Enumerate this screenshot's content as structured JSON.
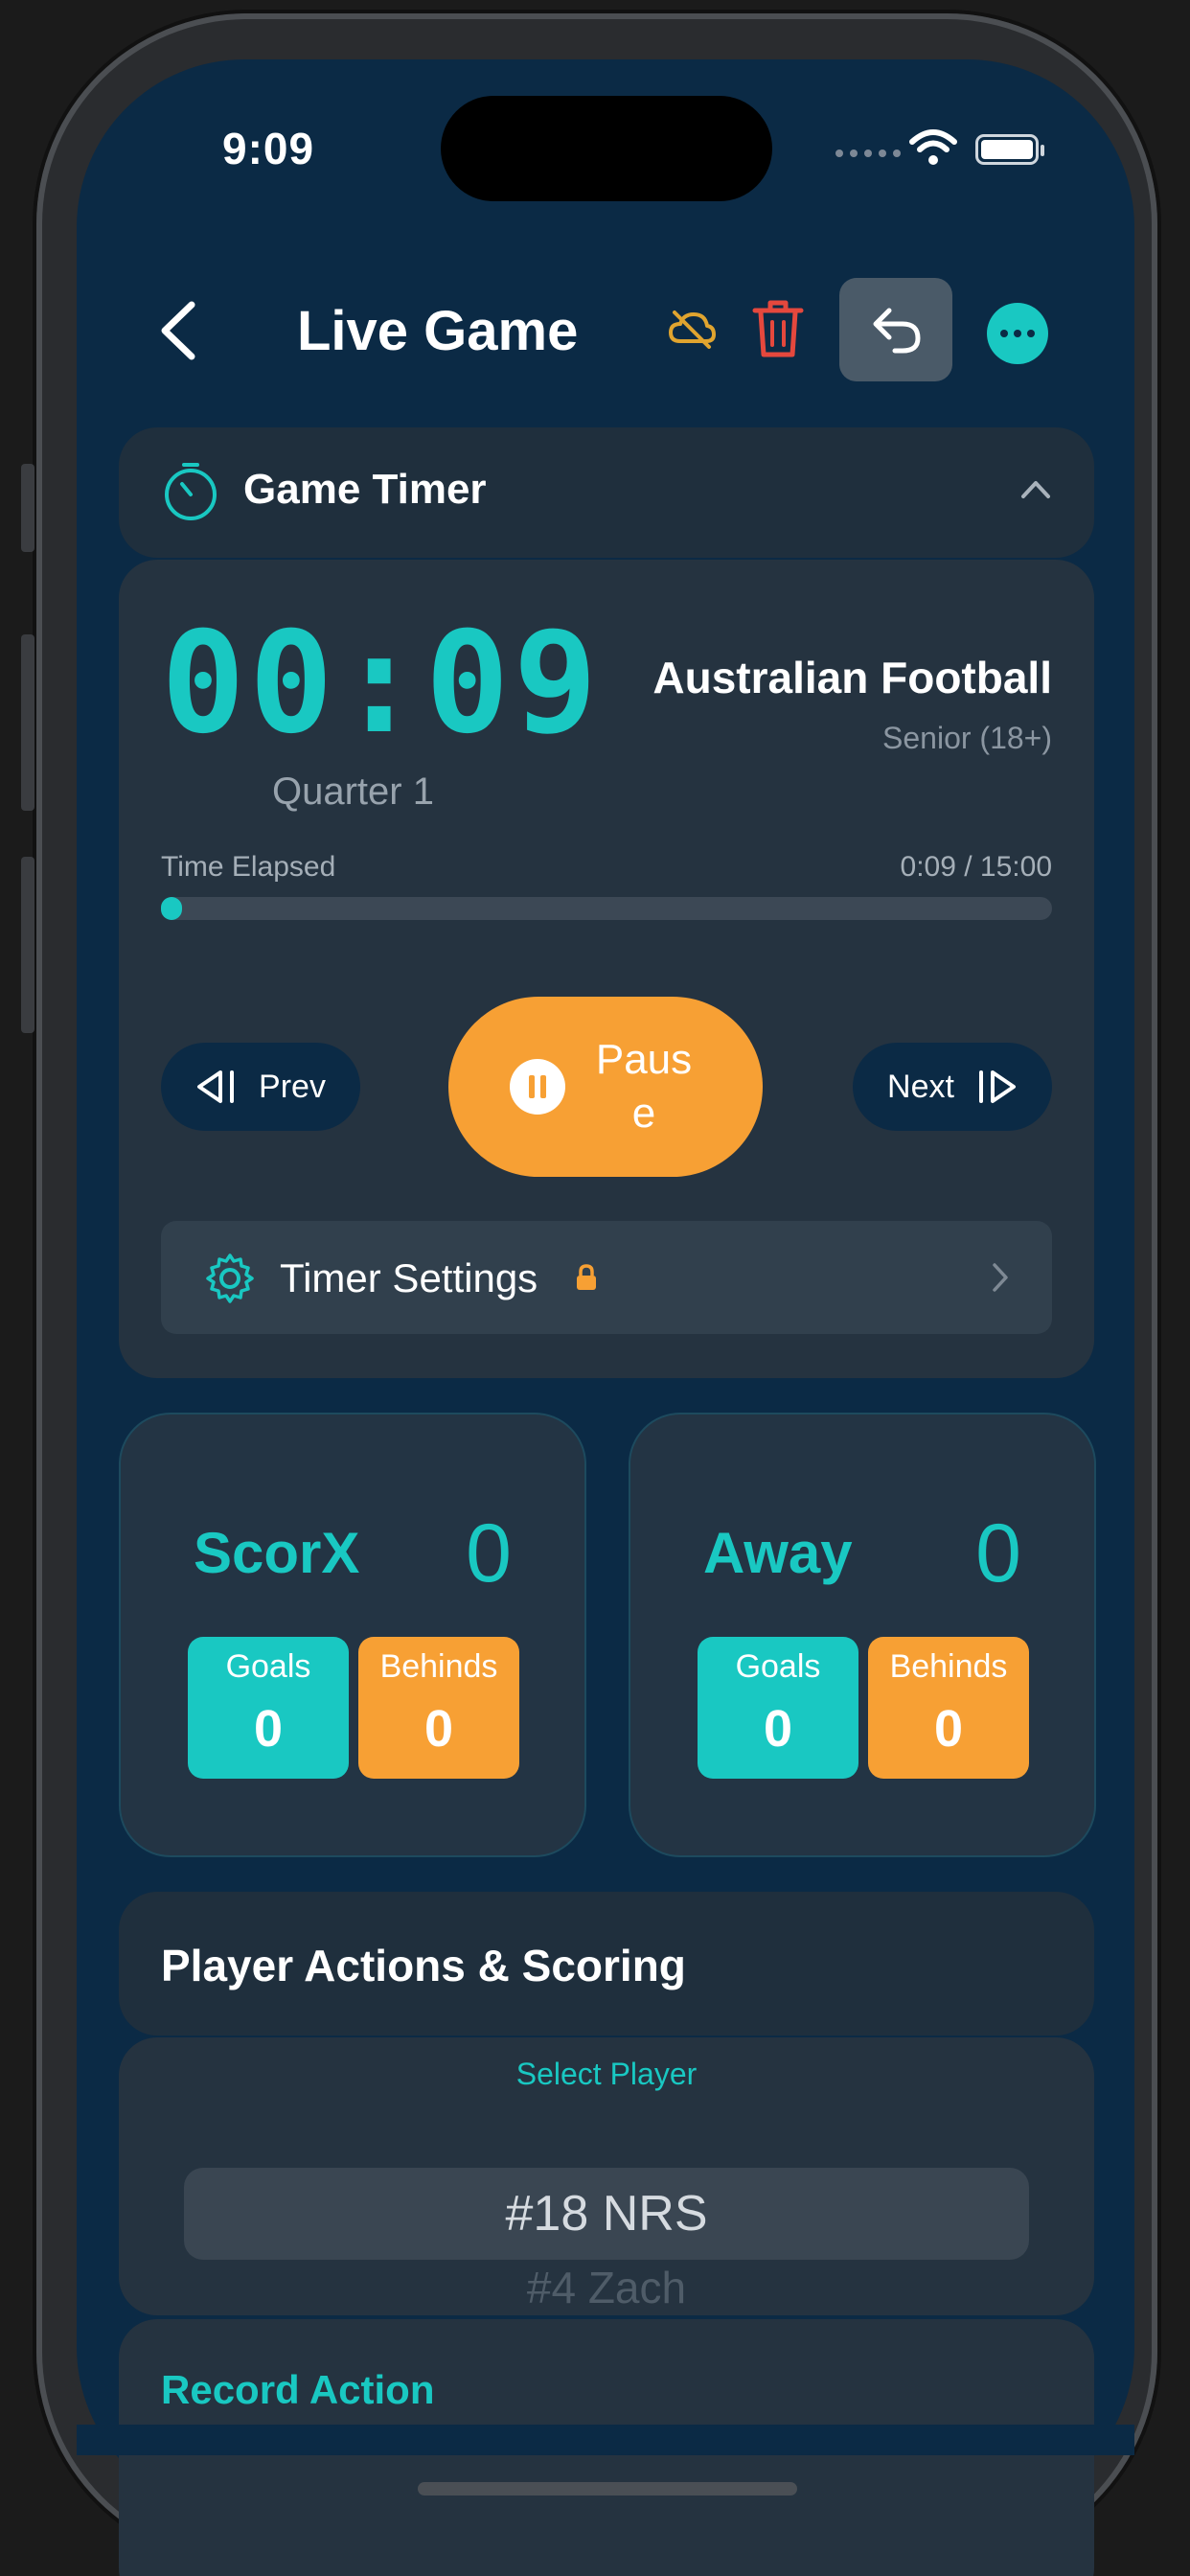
{
  "status_bar": {
    "time": "9:09"
  },
  "nav": {
    "title": "Live Game"
  },
  "timer": {
    "section_title": "Game Timer",
    "clock": "00:09",
    "period": "Quarter 1",
    "sport": "Australian Football",
    "division": "Senior (18+)",
    "elapsed_label": "Time Elapsed",
    "elapsed_value": "0:09 / 15:00",
    "progress_fraction": 0.01,
    "prev_label": "Prev",
    "pause_label": "Pause",
    "next_label": "Next",
    "settings_label": "Timer Settings"
  },
  "teams": {
    "home": {
      "name": "ScorX",
      "score": "0",
      "goals_label": "Goals",
      "goals": "0",
      "behinds_label": "Behinds",
      "behinds": "0"
    },
    "away": {
      "name": "Away",
      "score": "0",
      "goals_label": "Goals",
      "goals": "0",
      "behinds_label": "Behinds",
      "behinds": "0"
    }
  },
  "actions": {
    "section_title": "Player Actions & Scoring",
    "select_player_label": "Select Player",
    "selected_player": "#18 NRS",
    "next_player": "#4 Zach",
    "record_action_title": "Record Action"
  },
  "colors": {
    "accent": "#19c8c2",
    "orange": "#f7a034",
    "background": "#0b2a45",
    "danger": "#e5483d"
  }
}
